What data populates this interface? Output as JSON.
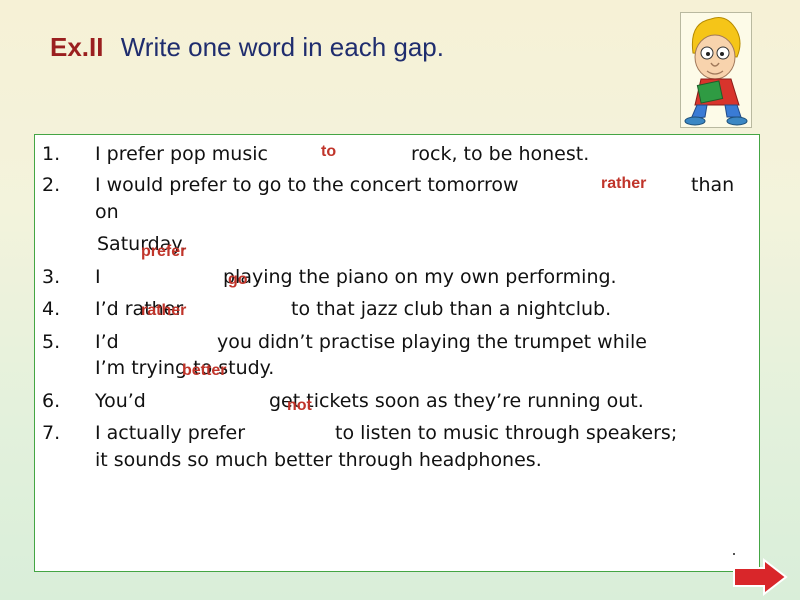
{
  "title": {
    "number": "Ex.II",
    "text": "Write one word in each gap."
  },
  "items": [
    {
      "num": "1.",
      "line1": "I prefer pop music",
      "line1b": "rock, to be honest.",
      "answer": "to"
    },
    {
      "num": "2.",
      "line1": "I would prefer to go to the concert tomorrow",
      "line1b": "than",
      "line2": "on",
      "line3": "Saturday.",
      "answer": "rather"
    },
    {
      "num": "3.",
      "line1": "I",
      "line1b": "playing the piano on my own performing.",
      "answer": "prefer"
    },
    {
      "num": "4.",
      "line1": "I’d rather",
      "line1b": "to that jazz club than a nightclub.",
      "answer": "go"
    },
    {
      "num": "5.",
      "line1": "I’d",
      "line1b": "you didn’t practise playing the trumpet while",
      "line2": "I’m trying to study.",
      "answer": "rather"
    },
    {
      "num": "6.",
      "line1": "You’d",
      "line1b": "get tickets soon as they’re running out.",
      "answer": "better"
    },
    {
      "num": "7.",
      "line1": "I actually prefer",
      "line1b": "to listen to music through speakers;",
      "line2": "it sounds so much better through headphones.",
      "answer": "not"
    }
  ],
  "colors": {
    "title_number": "#9a1f1f",
    "title_text": "#1f2d6e",
    "answer": "#c0342a",
    "panel_border": "#44a544",
    "next_arrow": "#d9262a"
  },
  "icons": {
    "avatar": "boy-reading-book-icon",
    "next": "next-arrow-icon"
  }
}
